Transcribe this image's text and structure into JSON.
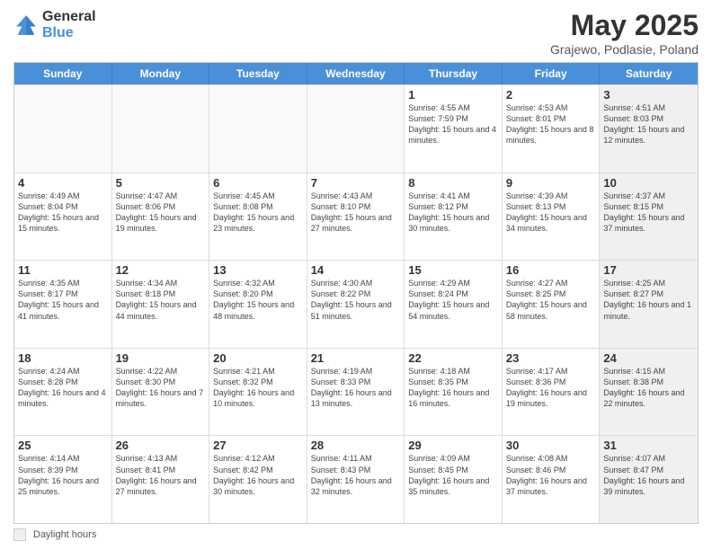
{
  "logo": {
    "line1": "General",
    "line2": "Blue"
  },
  "title": "May 2025",
  "subtitle": "Grajewo, Podlasie, Poland",
  "days_of_week": [
    "Sunday",
    "Monday",
    "Tuesday",
    "Wednesday",
    "Thursday",
    "Friday",
    "Saturday"
  ],
  "footer": {
    "legend_label": "Daylight hours"
  },
  "weeks": [
    [
      {
        "day": "",
        "info": "",
        "empty": true
      },
      {
        "day": "",
        "info": "",
        "empty": true
      },
      {
        "day": "",
        "info": "",
        "empty": true
      },
      {
        "day": "",
        "info": "",
        "empty": true
      },
      {
        "day": "1",
        "info": "Sunrise: 4:55 AM\nSunset: 7:59 PM\nDaylight: 15 hours\nand 4 minutes.",
        "empty": false
      },
      {
        "day": "2",
        "info": "Sunrise: 4:53 AM\nSunset: 8:01 PM\nDaylight: 15 hours\nand 8 minutes.",
        "empty": false
      },
      {
        "day": "3",
        "info": "Sunrise: 4:51 AM\nSunset: 8:03 PM\nDaylight: 15 hours\nand 12 minutes.",
        "empty": false,
        "shaded": true
      }
    ],
    [
      {
        "day": "4",
        "info": "Sunrise: 4:49 AM\nSunset: 8:04 PM\nDaylight: 15 hours\nand 15 minutes.",
        "empty": false
      },
      {
        "day": "5",
        "info": "Sunrise: 4:47 AM\nSunset: 8:06 PM\nDaylight: 15 hours\nand 19 minutes.",
        "empty": false
      },
      {
        "day": "6",
        "info": "Sunrise: 4:45 AM\nSunset: 8:08 PM\nDaylight: 15 hours\nand 23 minutes.",
        "empty": false
      },
      {
        "day": "7",
        "info": "Sunrise: 4:43 AM\nSunset: 8:10 PM\nDaylight: 15 hours\nand 27 minutes.",
        "empty": false
      },
      {
        "day": "8",
        "info": "Sunrise: 4:41 AM\nSunset: 8:12 PM\nDaylight: 15 hours\nand 30 minutes.",
        "empty": false
      },
      {
        "day": "9",
        "info": "Sunrise: 4:39 AM\nSunset: 8:13 PM\nDaylight: 15 hours\nand 34 minutes.",
        "empty": false
      },
      {
        "day": "10",
        "info": "Sunrise: 4:37 AM\nSunset: 8:15 PM\nDaylight: 15 hours\nand 37 minutes.",
        "empty": false,
        "shaded": true
      }
    ],
    [
      {
        "day": "11",
        "info": "Sunrise: 4:35 AM\nSunset: 8:17 PM\nDaylight: 15 hours\nand 41 minutes.",
        "empty": false
      },
      {
        "day": "12",
        "info": "Sunrise: 4:34 AM\nSunset: 8:18 PM\nDaylight: 15 hours\nand 44 minutes.",
        "empty": false
      },
      {
        "day": "13",
        "info": "Sunrise: 4:32 AM\nSunset: 8:20 PM\nDaylight: 15 hours\nand 48 minutes.",
        "empty": false
      },
      {
        "day": "14",
        "info": "Sunrise: 4:30 AM\nSunset: 8:22 PM\nDaylight: 15 hours\nand 51 minutes.",
        "empty": false
      },
      {
        "day": "15",
        "info": "Sunrise: 4:29 AM\nSunset: 8:24 PM\nDaylight: 15 hours\nand 54 minutes.",
        "empty": false
      },
      {
        "day": "16",
        "info": "Sunrise: 4:27 AM\nSunset: 8:25 PM\nDaylight: 15 hours\nand 58 minutes.",
        "empty": false
      },
      {
        "day": "17",
        "info": "Sunrise: 4:25 AM\nSunset: 8:27 PM\nDaylight: 16 hours\nand 1 minute.",
        "empty": false,
        "shaded": true
      }
    ],
    [
      {
        "day": "18",
        "info": "Sunrise: 4:24 AM\nSunset: 8:28 PM\nDaylight: 16 hours\nand 4 minutes.",
        "empty": false
      },
      {
        "day": "19",
        "info": "Sunrise: 4:22 AM\nSunset: 8:30 PM\nDaylight: 16 hours\nand 7 minutes.",
        "empty": false
      },
      {
        "day": "20",
        "info": "Sunrise: 4:21 AM\nSunset: 8:32 PM\nDaylight: 16 hours\nand 10 minutes.",
        "empty": false
      },
      {
        "day": "21",
        "info": "Sunrise: 4:19 AM\nSunset: 8:33 PM\nDaylight: 16 hours\nand 13 minutes.",
        "empty": false
      },
      {
        "day": "22",
        "info": "Sunrise: 4:18 AM\nSunset: 8:35 PM\nDaylight: 16 hours\nand 16 minutes.",
        "empty": false
      },
      {
        "day": "23",
        "info": "Sunrise: 4:17 AM\nSunset: 8:36 PM\nDaylight: 16 hours\nand 19 minutes.",
        "empty": false
      },
      {
        "day": "24",
        "info": "Sunrise: 4:15 AM\nSunset: 8:38 PM\nDaylight: 16 hours\nand 22 minutes.",
        "empty": false,
        "shaded": true
      }
    ],
    [
      {
        "day": "25",
        "info": "Sunrise: 4:14 AM\nSunset: 8:39 PM\nDaylight: 16 hours\nand 25 minutes.",
        "empty": false
      },
      {
        "day": "26",
        "info": "Sunrise: 4:13 AM\nSunset: 8:41 PM\nDaylight: 16 hours\nand 27 minutes.",
        "empty": false
      },
      {
        "day": "27",
        "info": "Sunrise: 4:12 AM\nSunset: 8:42 PM\nDaylight: 16 hours\nand 30 minutes.",
        "empty": false
      },
      {
        "day": "28",
        "info": "Sunrise: 4:11 AM\nSunset: 8:43 PM\nDaylight: 16 hours\nand 32 minutes.",
        "empty": false
      },
      {
        "day": "29",
        "info": "Sunrise: 4:09 AM\nSunset: 8:45 PM\nDaylight: 16 hours\nand 35 minutes.",
        "empty": false
      },
      {
        "day": "30",
        "info": "Sunrise: 4:08 AM\nSunset: 8:46 PM\nDaylight: 16 hours\nand 37 minutes.",
        "empty": false
      },
      {
        "day": "31",
        "info": "Sunrise: 4:07 AM\nSunset: 8:47 PM\nDaylight: 16 hours\nand 39 minutes.",
        "empty": false,
        "shaded": true
      }
    ]
  ]
}
